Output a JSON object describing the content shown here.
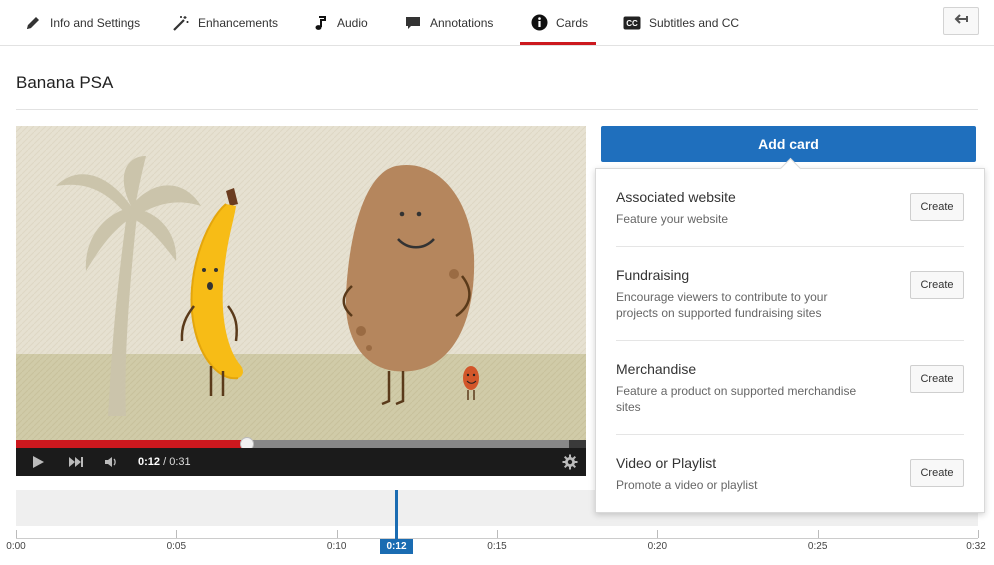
{
  "tabs": [
    {
      "label": "Info and Settings",
      "icon": "pencil-icon"
    },
    {
      "label": "Enhancements",
      "icon": "magic-wand-icon"
    },
    {
      "label": "Audio",
      "icon": "music-note-icon"
    },
    {
      "label": "Annotations",
      "icon": "speech-bubble-icon"
    },
    {
      "label": "Cards",
      "icon": "info-icon",
      "active": true
    },
    {
      "label": "Subtitles and CC",
      "icon": "cc-icon"
    }
  ],
  "back_button_icon": "back-arrow-icon",
  "video_title": "Banana PSA",
  "player": {
    "current_time": "0:12",
    "separator": "/",
    "duration": "0:31",
    "played_fraction": 0.406,
    "loaded_fraction": 0.97
  },
  "timeline": {
    "ticks": [
      "0:00",
      "0:05",
      "0:10",
      "0:15",
      "0:20",
      "0:25",
      "0:32"
    ],
    "playhead_label": "0:12",
    "playhead_seconds": 12.6,
    "total_seconds": 32
  },
  "add_card": {
    "label": "Add card"
  },
  "card_types": [
    {
      "name": "Associated website",
      "description": "Feature your website",
      "action": "Create"
    },
    {
      "name": "Fundraising",
      "description": "Encourage viewers to contribute to your projects on supported fundraising sites",
      "action": "Create"
    },
    {
      "name": "Merchandise",
      "description": "Feature a product on supported merchandise sites",
      "action": "Create"
    },
    {
      "name": "Video or Playlist",
      "description": "Promote a video or playlist",
      "action": "Create"
    }
  ],
  "colors": {
    "accent_red": "#cc181e",
    "primary_blue": "#1f6fbd",
    "playhead_blue": "#1a6cb2"
  }
}
